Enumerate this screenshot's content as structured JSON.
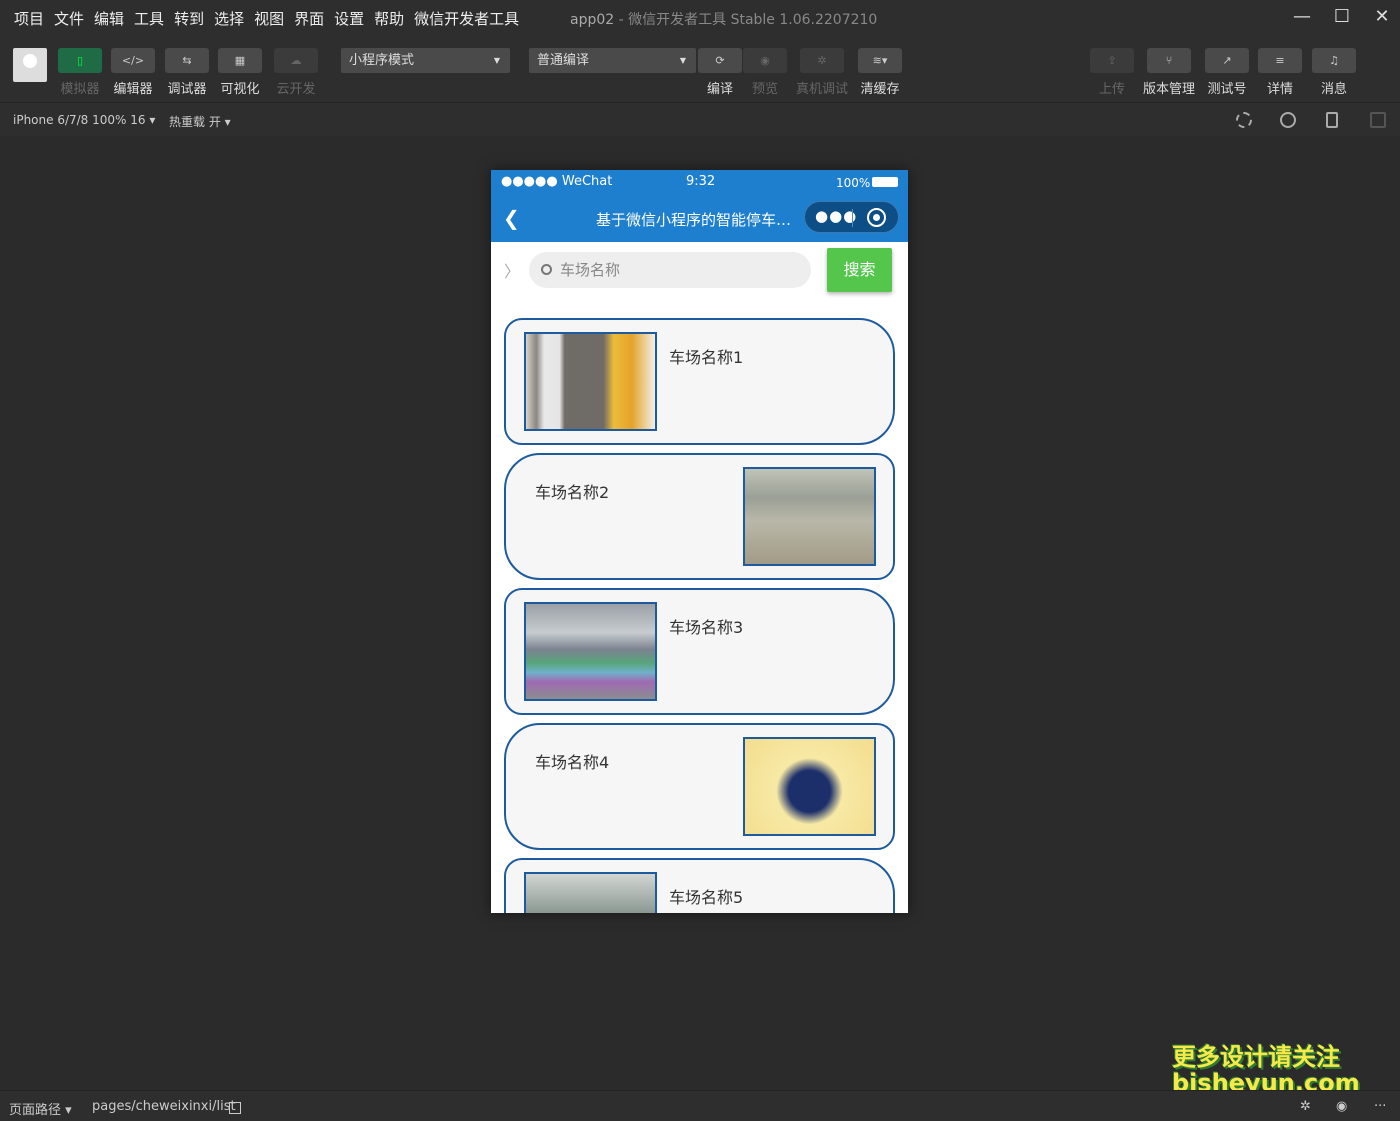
{
  "menubar": {
    "items": [
      "项目",
      "文件",
      "编辑",
      "工具",
      "转到",
      "选择",
      "视图",
      "界面",
      "设置",
      "帮助",
      "微信开发者工具"
    ],
    "title_app": "app02",
    "title_rest": "- 微信开发者工具 Stable 1.06.2207210"
  },
  "toolbar": {
    "simulator_label": "模拟器",
    "editor_label": "编辑器",
    "debugger_label": "调试器",
    "visual_label": "可视化",
    "cloud_label": "云开发",
    "mode_select": "小程序模式",
    "compile_select": "普通编译",
    "compile_label": "编译",
    "preview_label": "预览",
    "real_debug_label": "真机调试",
    "clear_cache_label": "清缓存",
    "upload_label": "上传",
    "version_label": "版本管理",
    "test_label": "测试号",
    "detail_label": "详情",
    "message_label": "消息"
  },
  "devbar": {
    "device": "iPhone 6/7/8 100% 16 ▾",
    "hot_reload": "热重载 开 ▾"
  },
  "phone": {
    "status_signal": "●●●●● WeChat",
    "status_time": "9:32",
    "status_battery": "100%",
    "nav_title": "基于微信小程序的智能停车场...",
    "search_placeholder": "车场名称",
    "search_button": "搜索",
    "cards": [
      {
        "name": "车场名称1"
      },
      {
        "name": "车场名称2"
      },
      {
        "name": "车场名称3"
      },
      {
        "name": "车场名称4"
      },
      {
        "name": "车场名称5"
      }
    ]
  },
  "footer": {
    "path_label": "页面路径 ▾",
    "path_value": "pages/cheweixinxi/list"
  },
  "watermark": {
    "line1": "更多设计请关注",
    "line2": "bisheyun.com"
  }
}
